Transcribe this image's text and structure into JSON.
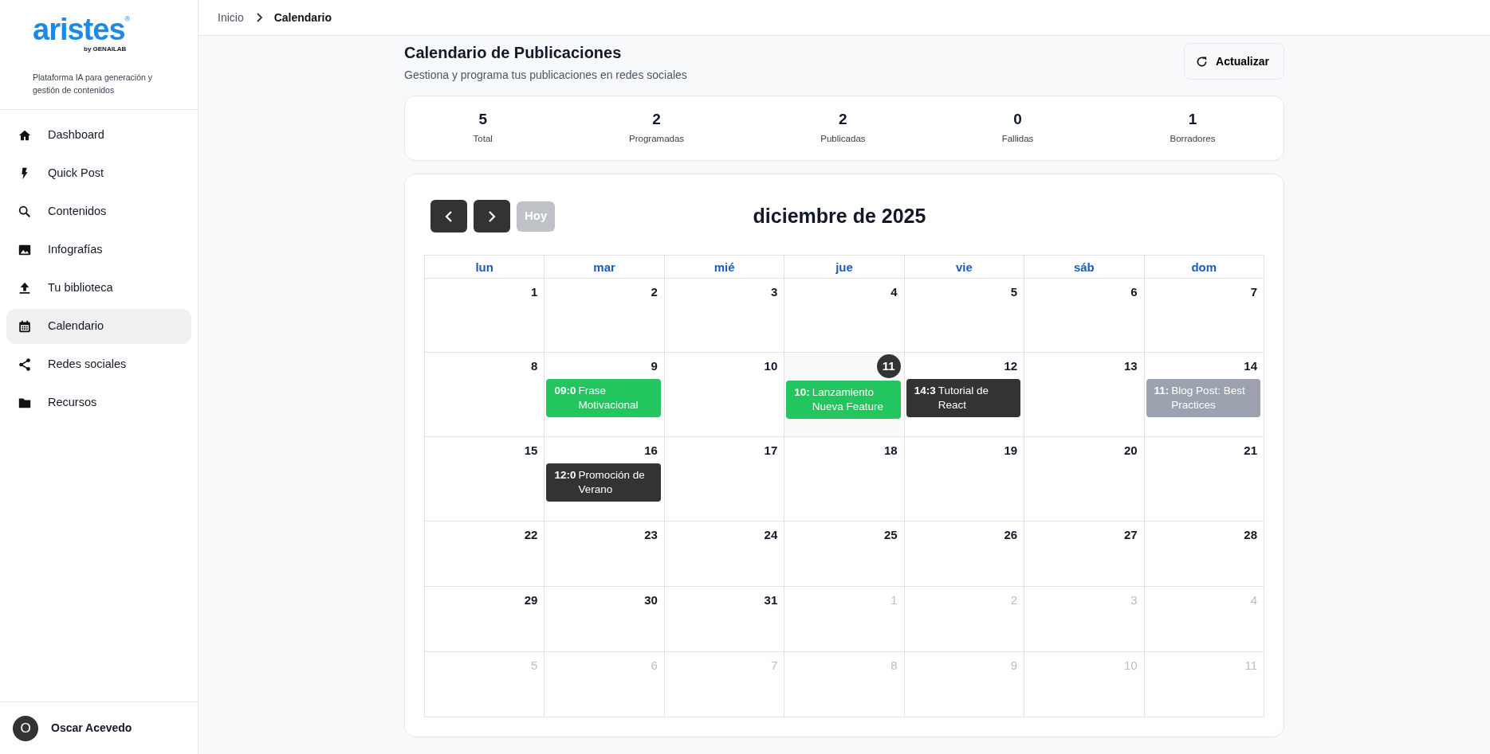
{
  "logo": {
    "name": "aristes",
    "mark": "®",
    "by": "by GENAILAB",
    "tagline": "Plataforma IA para generación y gestión de contenidos"
  },
  "sidebar": {
    "items": [
      {
        "label": "Dashboard",
        "selected": false
      },
      {
        "label": "Quick Post",
        "selected": false
      },
      {
        "label": "Contenidos",
        "selected": false
      },
      {
        "label": "Infografías",
        "selected": false
      },
      {
        "label": "Tu biblioteca",
        "selected": false
      },
      {
        "label": "Calendario",
        "selected": true
      },
      {
        "label": "Redes sociales",
        "selected": false
      },
      {
        "label": "Recursos",
        "selected": false
      }
    ],
    "user": {
      "initial": "O",
      "name": "Oscar Acevedo"
    }
  },
  "breadcrumb": [
    "Inicio",
    "Calendario"
  ],
  "page": {
    "title": "Calendario de Publicaciones",
    "subtitle": "Gestiona y programa tus publicaciones en redes sociales",
    "refresh_button": "Actualizar"
  },
  "stats": [
    {
      "value": "5",
      "label": "Total"
    },
    {
      "value": "2",
      "label": "Programadas"
    },
    {
      "value": "2",
      "label": "Publicadas"
    },
    {
      "value": "0",
      "label": "Fallidas"
    },
    {
      "value": "1",
      "label": "Borradores"
    }
  ],
  "calendar": {
    "title": "diciembre de 2025",
    "today_button": {
      "label": "Hoy",
      "disabled": true
    },
    "weekdays": [
      "lun",
      "mar",
      "mié",
      "jue",
      "vie",
      "sáb",
      "dom"
    ],
    "weeks": [
      [
        {
          "day": "1",
          "outside": false,
          "today": false
        },
        {
          "day": "2",
          "outside": false,
          "today": false
        },
        {
          "day": "3",
          "outside": false,
          "today": false
        },
        {
          "day": "4",
          "outside": false,
          "today": false
        },
        {
          "day": "5",
          "outside": false,
          "today": false
        },
        {
          "day": "6",
          "outside": false,
          "today": false
        },
        {
          "day": "7",
          "outside": false,
          "today": false
        }
      ],
      [
        {
          "day": "8",
          "outside": false,
          "today": false
        },
        {
          "day": "9",
          "outside": false,
          "today": false,
          "events": [
            {
              "time": "09:0",
              "title": "Frase Motivacional",
              "color": "#22c55e"
            }
          ]
        },
        {
          "day": "10",
          "outside": false,
          "today": false
        },
        {
          "day": "11",
          "outside": false,
          "today": true,
          "events": [
            {
              "time": "10:",
              "title": "Lanzamiento Nueva Feature",
              "color": "#22c55e"
            }
          ]
        },
        {
          "day": "12",
          "outside": false,
          "today": false,
          "events": [
            {
              "time": "14:3",
              "title": "Tutorial de React",
              "color": "#333333"
            }
          ]
        },
        {
          "day": "13",
          "outside": false,
          "today": false
        },
        {
          "day": "14",
          "outside": false,
          "today": false,
          "events": [
            {
              "time": "11:",
              "title": "Blog Post: Best Practices",
              "color": "#9ca3af"
            }
          ]
        }
      ],
      [
        {
          "day": "15",
          "outside": false,
          "today": false
        },
        {
          "day": "16",
          "outside": false,
          "today": false,
          "events": [
            {
              "time": "12:0",
              "title": "Promoción de Verano",
              "color": "#333333"
            }
          ]
        },
        {
          "day": "17",
          "outside": false,
          "today": false
        },
        {
          "day": "18",
          "outside": false,
          "today": false
        },
        {
          "day": "19",
          "outside": false,
          "today": false
        },
        {
          "day": "20",
          "outside": false,
          "today": false
        },
        {
          "day": "21",
          "outside": false,
          "today": false
        }
      ],
      [
        {
          "day": "22",
          "outside": false,
          "today": false
        },
        {
          "day": "23",
          "outside": false,
          "today": false
        },
        {
          "day": "24",
          "outside": false,
          "today": false
        },
        {
          "day": "25",
          "outside": false,
          "today": false
        },
        {
          "day": "26",
          "outside": false,
          "today": false
        },
        {
          "day": "27",
          "outside": false,
          "today": false
        },
        {
          "day": "28",
          "outside": false,
          "today": false
        }
      ],
      [
        {
          "day": "29",
          "outside": false,
          "today": false
        },
        {
          "day": "30",
          "outside": false,
          "today": false
        },
        {
          "day": "31",
          "outside": false,
          "today": false
        },
        {
          "day": "1",
          "outside": true,
          "today": false
        },
        {
          "day": "2",
          "outside": true,
          "today": false
        },
        {
          "day": "3",
          "outside": true,
          "today": false
        },
        {
          "day": "4",
          "outside": true,
          "today": false
        }
      ],
      [
        {
          "day": "5",
          "outside": true,
          "today": false
        },
        {
          "day": "6",
          "outside": true,
          "today": false
        },
        {
          "day": "7",
          "outside": true,
          "today": false
        },
        {
          "day": "8",
          "outside": true,
          "today": false
        },
        {
          "day": "9",
          "outside": true,
          "today": false
        },
        {
          "day": "10",
          "outside": true,
          "today": false
        },
        {
          "day": "11",
          "outside": true,
          "today": false
        }
      ]
    ]
  }
}
